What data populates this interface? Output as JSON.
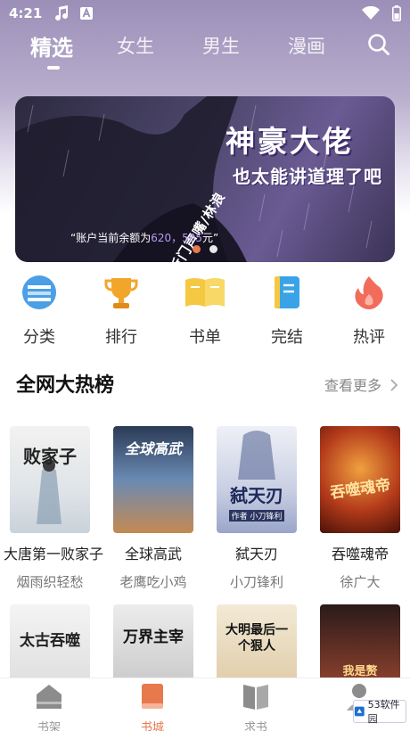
{
  "status_bar": {
    "time": "4:21"
  },
  "nav": {
    "tabs": [
      {
        "label": "精选",
        "active": true
      },
      {
        "label": "女生",
        "active": false
      },
      {
        "label": "男生",
        "active": false
      },
      {
        "label": "漫画",
        "active": false
      }
    ]
  },
  "banner": {
    "title": "神豪大佬",
    "subtitle": "也太能讲道理了吧",
    "side_text": "听门声嘴/林浪",
    "quote_prefix": "“账户当前余额为",
    "quote_amount": "620，505",
    "quote_suffix": "元”",
    "slide_count": 2,
    "active_slide": 1
  },
  "categories": [
    {
      "label": "分类",
      "icon": "category-icon",
      "color": "#4a9fe6"
    },
    {
      "label": "排行",
      "icon": "trophy-icon",
      "color": "#f2a52b"
    },
    {
      "label": "书单",
      "icon": "book-list-icon",
      "color": "#f5c842"
    },
    {
      "label": "完结",
      "icon": "finished-book-icon",
      "color": "#3aa3e8"
    },
    {
      "label": "热评",
      "icon": "hot-comment-icon",
      "color": "#f26b5b"
    }
  ],
  "hot_list": {
    "title": "全网大热榜",
    "see_more": "查看更多",
    "books": [
      {
        "title": "大唐第一败家子",
        "author": "烟雨织轻愁",
        "cover_text": "败家子"
      },
      {
        "title": "全球高武",
        "author": "老鹰吃小鸡",
        "cover_text": "全球高武"
      },
      {
        "title": "弑天刃",
        "author": "小刀锋利",
        "cover_text": "弑天刃",
        "cover_caption": "作者 小刀锋利"
      },
      {
        "title": "吞噬魂帝",
        "author": "徐广大",
        "cover_text": "吞噬魂帝"
      }
    ],
    "books_row2": [
      {
        "cover_text": "太古吞噬"
      },
      {
        "cover_text": "万界主宰"
      },
      {
        "cover_text": "大明最后一个狠人"
      },
      {
        "cover_text": "我是赘"
      }
    ]
  },
  "tabbar": {
    "tabs": [
      {
        "label": "书架",
        "active": false
      },
      {
        "label": "书城",
        "active": true
      },
      {
        "label": "求书",
        "active": false
      },
      {
        "label": "",
        "active": false
      }
    ]
  },
  "watermark": {
    "text": "53软件园"
  },
  "colors": {
    "accent": "#e8794d",
    "header": "#9b8fb8"
  }
}
